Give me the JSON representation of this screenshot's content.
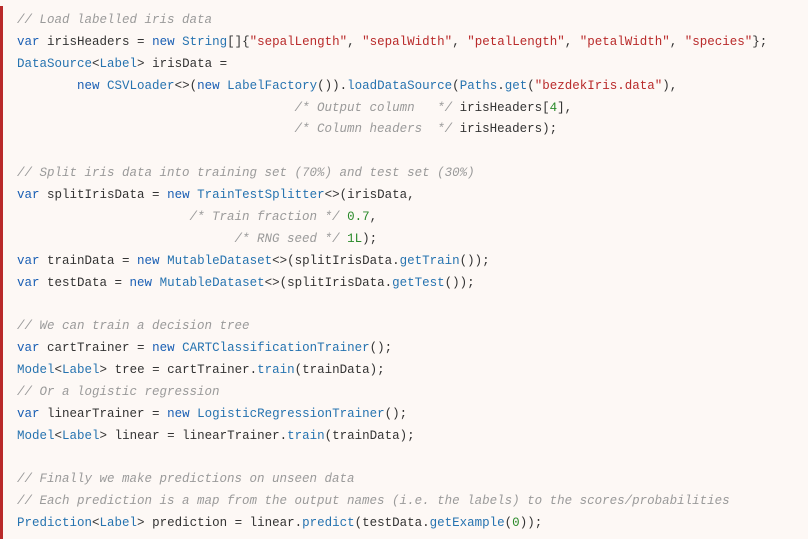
{
  "lines": [
    [
      [
        "cm",
        "// Load labelled iris data"
      ]
    ],
    [
      [
        "kw",
        "var"
      ],
      [
        "id",
        " irisHeaders "
      ],
      [
        "op",
        "= "
      ],
      [
        "kw",
        "new"
      ],
      [
        "id",
        " "
      ],
      [
        "ty",
        "String"
      ],
      [
        "op",
        "[]{"
      ],
      [
        "str",
        "\"sepalLength\""
      ],
      [
        "op",
        ", "
      ],
      [
        "str",
        "\"sepalWidth\""
      ],
      [
        "op",
        ", "
      ],
      [
        "str",
        "\"petalLength\""
      ],
      [
        "op",
        ", "
      ],
      [
        "str",
        "\"petalWidth\""
      ],
      [
        "op",
        ", "
      ],
      [
        "str",
        "\"species\""
      ],
      [
        "op",
        "};"
      ]
    ],
    [
      [
        "ty",
        "DataSource"
      ],
      [
        "op",
        "<"
      ],
      [
        "ty",
        "Label"
      ],
      [
        "op",
        "> "
      ],
      [
        "id",
        "irisData "
      ],
      [
        "op",
        "="
      ]
    ],
    [
      [
        "id",
        "        "
      ],
      [
        "kw",
        "new"
      ],
      [
        "id",
        " "
      ],
      [
        "ty",
        "CSVLoader"
      ],
      [
        "op",
        "<>("
      ],
      [
        "kw",
        "new"
      ],
      [
        "id",
        " "
      ],
      [
        "ty",
        "LabelFactory"
      ],
      [
        "op",
        "())."
      ],
      [
        "fn",
        "loadDataSource"
      ],
      [
        "op",
        "("
      ],
      [
        "ty",
        "Paths"
      ],
      [
        "op",
        "."
      ],
      [
        "fn",
        "get"
      ],
      [
        "op",
        "("
      ],
      [
        "str",
        "\"bezdekIris.data\""
      ],
      [
        "op",
        "),"
      ]
    ],
    [
      [
        "id",
        "                                     "
      ],
      [
        "cm",
        "/* Output column   */"
      ],
      [
        "id",
        " irisHeaders["
      ],
      [
        "num",
        "4"
      ],
      [
        "op",
        "],"
      ]
    ],
    [
      [
        "id",
        "                                     "
      ],
      [
        "cm",
        "/* Column headers  */"
      ],
      [
        "id",
        " irisHeaders);"
      ]
    ],
    [
      [
        "id",
        ""
      ]
    ],
    [
      [
        "cm",
        "// Split iris data into training set (70%) and test set (30%)"
      ]
    ],
    [
      [
        "kw",
        "var"
      ],
      [
        "id",
        " splitIrisData "
      ],
      [
        "op",
        "= "
      ],
      [
        "kw",
        "new"
      ],
      [
        "id",
        " "
      ],
      [
        "ty",
        "TrainTestSplitter"
      ],
      [
        "op",
        "<>(irisData,"
      ]
    ],
    [
      [
        "id",
        "                       "
      ],
      [
        "cm",
        "/* Train fraction */"
      ],
      [
        "id",
        " "
      ],
      [
        "num",
        "0.7"
      ],
      [
        "op",
        ","
      ]
    ],
    [
      [
        "id",
        "                             "
      ],
      [
        "cm",
        "/* RNG seed */"
      ],
      [
        "id",
        " "
      ],
      [
        "num",
        "1L"
      ],
      [
        "op",
        ");"
      ]
    ],
    [
      [
        "kw",
        "var"
      ],
      [
        "id",
        " trainData "
      ],
      [
        "op",
        "= "
      ],
      [
        "kw",
        "new"
      ],
      [
        "id",
        " "
      ],
      [
        "ty",
        "MutableDataset"
      ],
      [
        "op",
        "<>(splitIrisData."
      ],
      [
        "fn",
        "getTrain"
      ],
      [
        "op",
        "());"
      ]
    ],
    [
      [
        "kw",
        "var"
      ],
      [
        "id",
        " testData "
      ],
      [
        "op",
        "= "
      ],
      [
        "kw",
        "new"
      ],
      [
        "id",
        " "
      ],
      [
        "ty",
        "MutableDataset"
      ],
      [
        "op",
        "<>(splitIrisData."
      ],
      [
        "fn",
        "getTest"
      ],
      [
        "op",
        "());"
      ]
    ],
    [
      [
        "id",
        ""
      ]
    ],
    [
      [
        "cm",
        "// We can train a decision tree"
      ]
    ],
    [
      [
        "kw",
        "var"
      ],
      [
        "id",
        " cartTrainer "
      ],
      [
        "op",
        "= "
      ],
      [
        "kw",
        "new"
      ],
      [
        "id",
        " "
      ],
      [
        "ty",
        "CARTClassificationTrainer"
      ],
      [
        "op",
        "();"
      ]
    ],
    [
      [
        "ty",
        "Model"
      ],
      [
        "op",
        "<"
      ],
      [
        "ty",
        "Label"
      ],
      [
        "op",
        "> "
      ],
      [
        "id",
        "tree "
      ],
      [
        "op",
        "= "
      ],
      [
        "id",
        "cartTrainer."
      ],
      [
        "fn",
        "train"
      ],
      [
        "op",
        "(trainData);"
      ]
    ],
    [
      [
        "cm",
        "// Or a logistic regression"
      ]
    ],
    [
      [
        "kw",
        "var"
      ],
      [
        "id",
        " linearTrainer "
      ],
      [
        "op",
        "= "
      ],
      [
        "kw",
        "new"
      ],
      [
        "id",
        " "
      ],
      [
        "ty",
        "LogisticRegressionTrainer"
      ],
      [
        "op",
        "();"
      ]
    ],
    [
      [
        "ty",
        "Model"
      ],
      [
        "op",
        "<"
      ],
      [
        "ty",
        "Label"
      ],
      [
        "op",
        "> "
      ],
      [
        "id",
        "linear "
      ],
      [
        "op",
        "= "
      ],
      [
        "id",
        "linearTrainer."
      ],
      [
        "fn",
        "train"
      ],
      [
        "op",
        "(trainData);"
      ]
    ],
    [
      [
        "id",
        ""
      ]
    ],
    [
      [
        "cm",
        "// Finally we make predictions on unseen data"
      ]
    ],
    [
      [
        "cm",
        "// Each prediction is a map from the output names (i.e. the labels) to the scores/probabilities"
      ]
    ],
    [
      [
        "ty",
        "Prediction"
      ],
      [
        "op",
        "<"
      ],
      [
        "ty",
        "Label"
      ],
      [
        "op",
        "> "
      ],
      [
        "id",
        "prediction "
      ],
      [
        "op",
        "= "
      ],
      [
        "id",
        "linear."
      ],
      [
        "fn",
        "predict"
      ],
      [
        "op",
        "(testData."
      ],
      [
        "fn",
        "getExample"
      ],
      [
        "op",
        "("
      ],
      [
        "num",
        "0"
      ],
      [
        "op",
        "));"
      ]
    ]
  ]
}
